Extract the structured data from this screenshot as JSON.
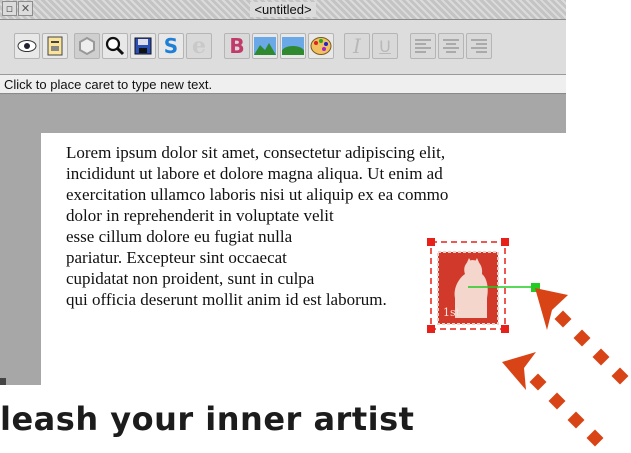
{
  "window": {
    "title": "<untitled>"
  },
  "toolbar": {
    "tools": [
      {
        "name": "view-icon"
      },
      {
        "name": "save-doc-icon"
      },
      {
        "name": "hexagon-icon"
      },
      {
        "name": "magnifier-icon"
      },
      {
        "name": "disk-icon"
      },
      {
        "name": "style-s-icon",
        "glyph": "S"
      },
      {
        "name": "euro-icon",
        "glyph": "€"
      },
      {
        "name": "bold-icon",
        "glyph": "B"
      },
      {
        "name": "landscape-icon"
      },
      {
        "name": "hill-icon"
      },
      {
        "name": "palette-icon"
      },
      {
        "name": "italic-icon",
        "glyph": "I"
      },
      {
        "name": "underline-icon",
        "glyph": "U"
      },
      {
        "name": "align-left-icon"
      },
      {
        "name": "align-center-icon"
      },
      {
        "name": "align-right-icon"
      }
    ]
  },
  "status": {
    "text": "Click to place caret to type new text."
  },
  "document": {
    "lines": [
      "Lorem ipsum dolor sit amet, consectetur adipiscing elit,",
      "incididunt ut labore et dolore magna aliqua. Ut enim ad",
      "exercitation ullamco laboris nisi ut aliquip ex ea commo",
      "dolor in reprehenderit in voluptate velit",
      "esse cillum dolore eu fugiat nulla",
      "pariatur. Excepteur sint occaecat",
      "cupidatat non proident, sunt in culpa",
      "qui officia deserunt mollit anim id est laborum."
    ],
    "stamp_text": "1st"
  },
  "tagline": "leash your inner artist",
  "colors": {
    "stamp_red": "#d13a2a",
    "handle_red": "#e8201a",
    "rotate_handle": "#22cc22",
    "arrow": "#d94416"
  }
}
